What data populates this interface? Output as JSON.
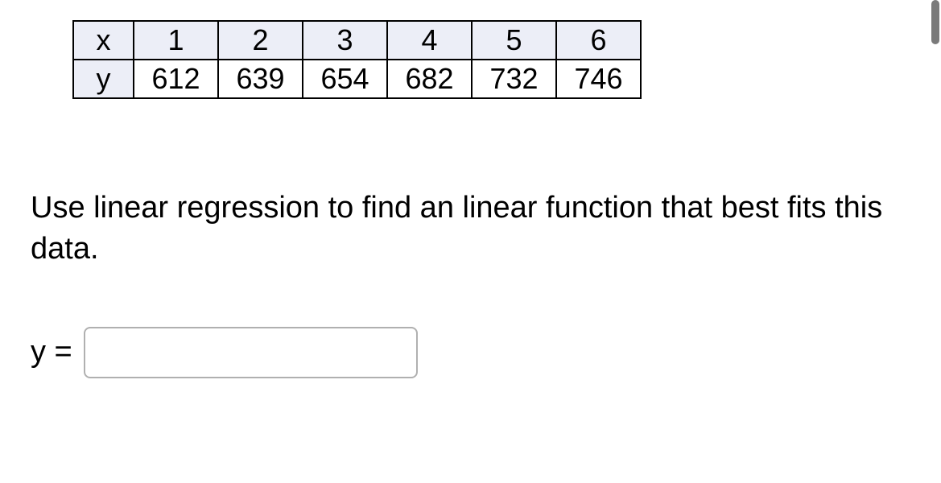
{
  "table": {
    "row_labels": [
      "x",
      "y"
    ],
    "x_values": [
      "1",
      "2",
      "3",
      "4",
      "5",
      "6"
    ],
    "y_values": [
      "612",
      "639",
      "654",
      "682",
      "732",
      "746"
    ]
  },
  "prompt": "Use linear regression to find an linear function that best fits this data.",
  "answer": {
    "label": "y =",
    "value": ""
  }
}
